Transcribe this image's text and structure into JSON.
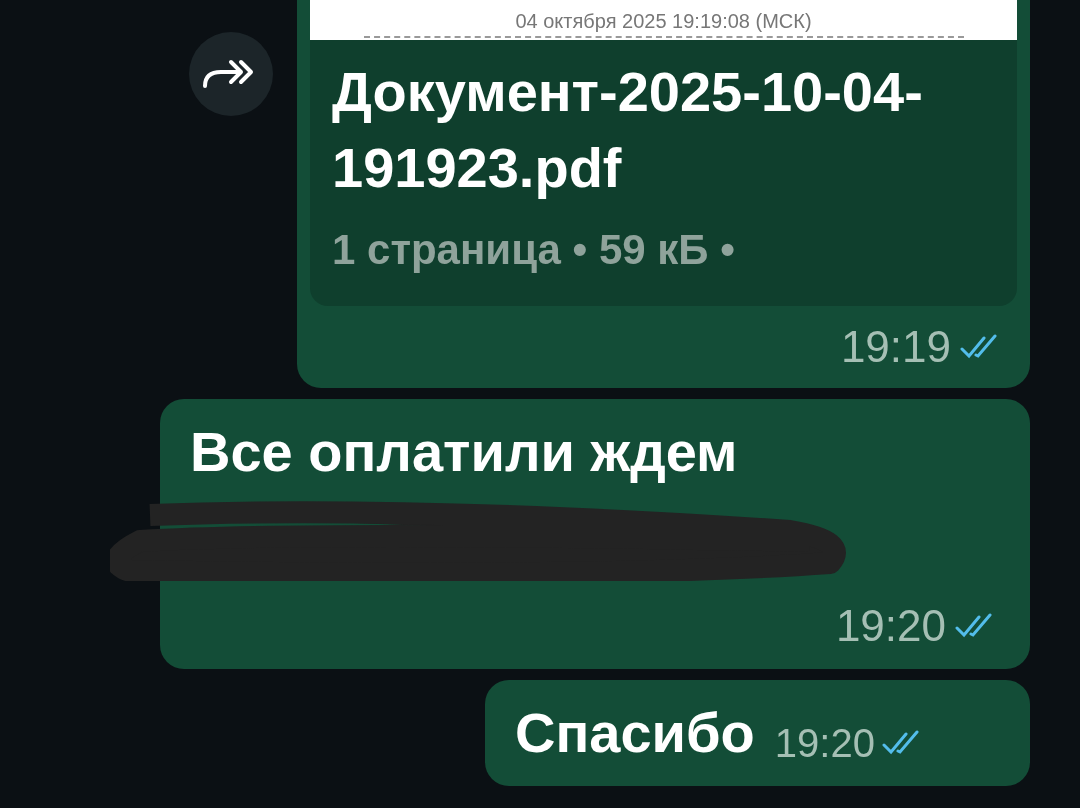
{
  "messages": [
    {
      "kind": "document",
      "preview_text": "04 октября 2025 19:19:08 (МСК)",
      "file_name": "Документ-2025-10-04-191923.pdf",
      "file_info": "1 страница • 59 кБ •",
      "time": "19:19",
      "read": true,
      "forward_button": true
    },
    {
      "kind": "text",
      "text": "Все оплатили ждем",
      "redacted": true,
      "time": "19:20",
      "read": true
    },
    {
      "kind": "text",
      "text": "Спасибо",
      "redacted": false,
      "time": "19:20",
      "read": true
    }
  ]
}
